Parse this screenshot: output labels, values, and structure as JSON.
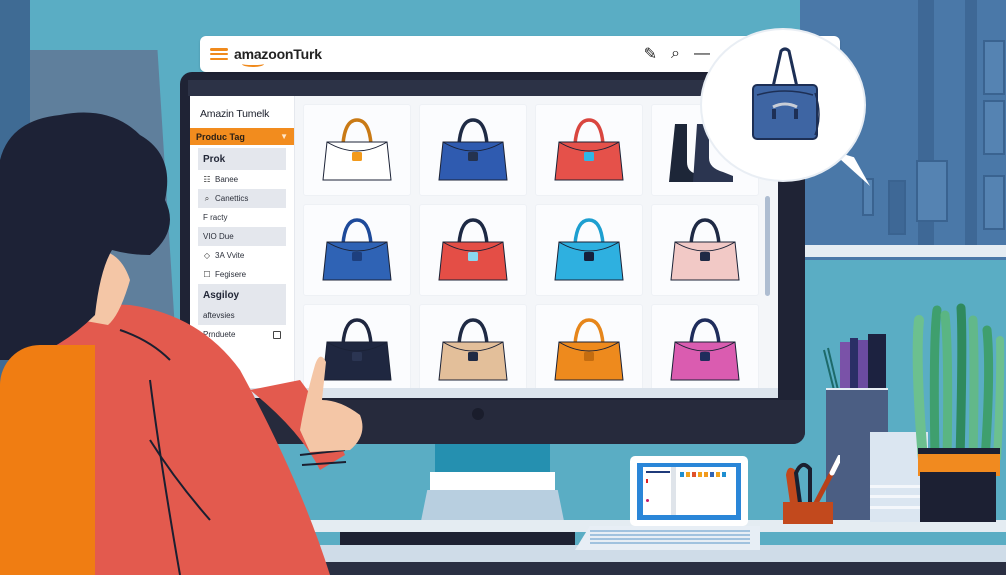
{
  "browser_bar": {
    "brand": "amazoonTurk",
    "tools": [
      {
        "name": "edit-icon",
        "glyph": "✎"
      },
      {
        "name": "search-icon",
        "glyph": "⌕"
      },
      {
        "name": "minimize-icon",
        "glyph": "—"
      }
    ]
  },
  "sidebar": {
    "title": "Amazin Tumelk",
    "dropdown": {
      "label": "Produc Tag",
      "icon": "chevron-down-icon"
    },
    "items": [
      {
        "label": "Prok",
        "style": "heading",
        "icon": ""
      },
      {
        "label": "Banee",
        "style": "plain",
        "icon": "list-icon"
      },
      {
        "label": "Canettics",
        "style": "shaded",
        "icon": "search-icon"
      },
      {
        "label": "F racty",
        "style": "plain",
        "icon": ""
      },
      {
        "label": "VIO Due",
        "style": "shaded",
        "icon": ""
      },
      {
        "label": "3A Vvite",
        "style": "plain",
        "icon": "tag-icon"
      },
      {
        "label": "Fegisere",
        "style": "plain",
        "icon": "checkbox-icon"
      },
      {
        "label": "Asgiloy",
        "style": "heading",
        "icon": ""
      },
      {
        "label": "aftevsies",
        "style": "shaded",
        "icon": ""
      },
      {
        "label": "Prnduete",
        "style": "plain",
        "icon": "",
        "checkbox": true
      }
    ]
  },
  "products": [
    {
      "name": "orange-white-handbag",
      "body": "#ffffff",
      "accent": "#f29a1c",
      "handle": "#c97a15"
    },
    {
      "name": "blue-tote",
      "body": "#2f5bb0",
      "accent": "#24324f",
      "handle": "#1f2b45"
    },
    {
      "name": "red-crossbody-bag",
      "body": "#e5514a",
      "accent": "#2fb6e6",
      "handle": "#d9463f"
    },
    {
      "name": "black-boots",
      "body": "#1d2638",
      "accent": "#2b3550",
      "handle": "#1d2638"
    },
    {
      "name": "blue-handbag",
      "body": "#2f63b5",
      "accent": "#1d3f7e",
      "handle": "#1e4a9a"
    },
    {
      "name": "red-satchel",
      "body": "#e44e46",
      "accent": "#8ad8ef",
      "handle": "#1d2944"
    },
    {
      "name": "cyan-duffel",
      "body": "#2eb0e0",
      "accent": "#15203b",
      "handle": "#1d9fd0"
    },
    {
      "name": "pink-purse",
      "body": "#f2c9c6",
      "accent": "#1f2a45",
      "handle": "#1f2a45"
    },
    {
      "name": "navy-handbag",
      "body": "#1f2740",
      "accent": "#2b3552",
      "handle": "#1f2740"
    },
    {
      "name": "beige-dome-bag",
      "body": "#e3bf9a",
      "accent": "#1f2a44",
      "handle": "#1f2a44"
    },
    {
      "name": "orange-satchel",
      "body": "#ee8a1d",
      "accent": "#c46c0f",
      "handle": "#e6861b"
    },
    {
      "name": "pink-messenger",
      "body": "#da5cb0",
      "accent": "#1f2d5c",
      "handle": "#1f2d5c"
    }
  ],
  "bubble": {
    "product": "navy-tote-bag",
    "body": "#3e65a3",
    "handle": "#1d2f55"
  },
  "laptop": {
    "swatches": [
      "#1f8fd1",
      "#f2a31c",
      "#e0522b",
      "#f2a31c",
      "#f29a1c",
      "#2f63b5",
      "#f2a31c",
      "#1f8fd1"
    ]
  },
  "colors": {
    "accent": "#f28c1e",
    "background": "#5aadc4",
    "monitor": "#1f2335"
  }
}
